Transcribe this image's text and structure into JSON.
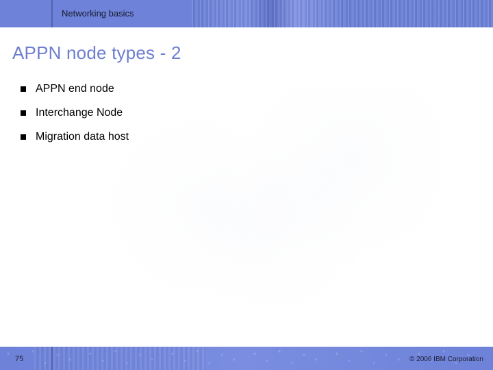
{
  "header": {
    "title": "Networking basics"
  },
  "slide": {
    "title": "APPN node types - 2",
    "bullets": [
      "APPN end node",
      "Interchange Node",
      "Migration data host"
    ]
  },
  "footer": {
    "page_number": "75",
    "copyright": "© 2006 IBM Corporation"
  }
}
